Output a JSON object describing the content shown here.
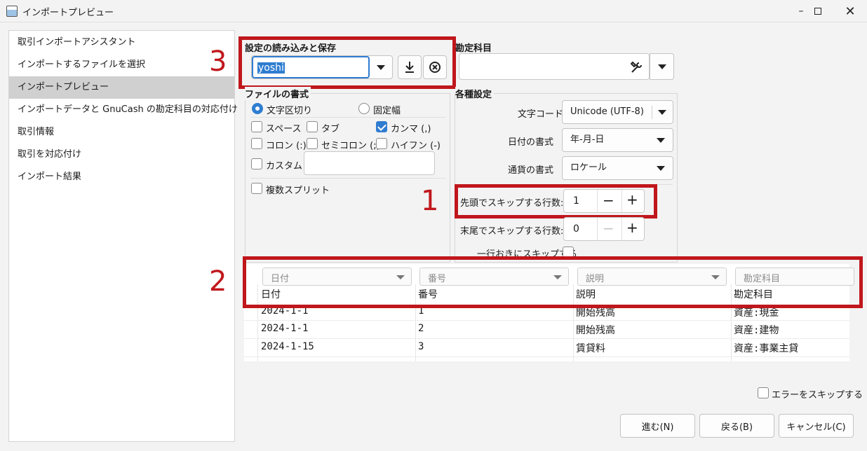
{
  "window": {
    "title": "インポートプレビュー"
  },
  "sidebar": {
    "items": [
      {
        "label": "取引インポートアシスタント"
      },
      {
        "label": "インポートするファイルを選択"
      },
      {
        "label": "インポートプレビュー"
      },
      {
        "label": "インポートデータと GnuCash の勘定科目の対応付け"
      },
      {
        "label": "取引情報"
      },
      {
        "label": "取引を対応付け"
      },
      {
        "label": "インポート結果"
      }
    ],
    "active_index": 2
  },
  "settings_group": {
    "title": "設定の読み込みと保存",
    "value": "yoshi"
  },
  "account_group": {
    "title": "勘定科目",
    "value": ""
  },
  "file_format": {
    "title": "ファイルの書式",
    "separated_label": "文字区切り",
    "fixed_label": "固定幅",
    "space_label": "スペース",
    "tab_label": "タブ",
    "comma_label": "カンマ (,)",
    "colon_label": "コロン (:)",
    "semicolon_label": "セミコロン (;)",
    "hyphen_label": "ハイフン (-)",
    "custom_label": "カスタム",
    "custom_value": "",
    "multi_split_label": "複数スプリット"
  },
  "misc_settings": {
    "title": "各種設定",
    "encoding_label": "文字コード",
    "encoding_value": "Unicode (UTF-8)",
    "date_format_label": "日付の書式",
    "date_format_value": "年-月-日",
    "currency_format_label": "通貨の書式",
    "currency_format_value": "ロケール",
    "skip_start_label": "先頭でスキップする行数:",
    "skip_start_value": "1",
    "skip_end_label": "末尾でスキップする行数:",
    "skip_end_value": "0",
    "skip_alt_label": "一行おきにスキップする"
  },
  "annotations": {
    "n1": "1",
    "n2": "2",
    "n3": "3"
  },
  "preview": {
    "column_types": [
      "日付",
      "番号",
      "説明",
      "勘定科目"
    ],
    "headers": [
      "日付",
      "番号",
      "説明",
      "勘定科目"
    ],
    "rows": [
      [
        "2024-1-1",
        "1",
        "開始残高",
        "資産:現金"
      ],
      [
        "2024-1-1",
        "2",
        "開始残高",
        "資産:建物"
      ],
      [
        "2024-1-15",
        "3",
        "賃貸料",
        "資産:事業主貸"
      ]
    ]
  },
  "skip_errors_label": "エラーをスキップする",
  "buttons": {
    "next": "進む(N)",
    "back": "戻る(B)",
    "cancel": "キャンセル(C)"
  },
  "colors": {
    "accent": "#2f7dd1",
    "annotation": "#c0171c"
  }
}
